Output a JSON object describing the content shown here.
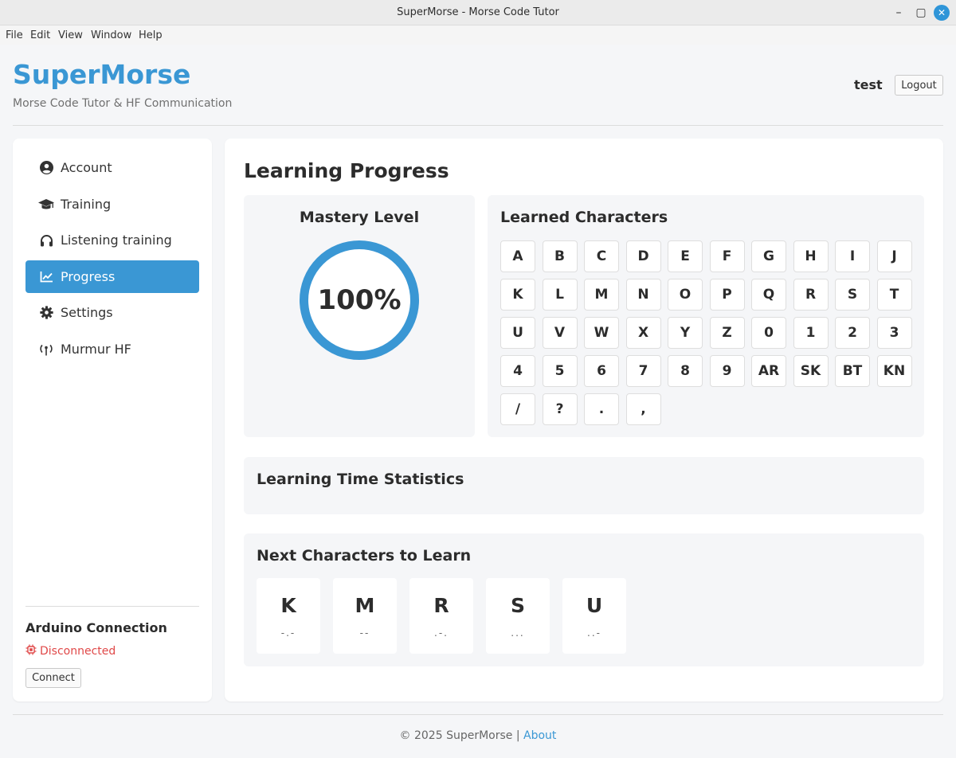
{
  "window": {
    "title": "SuperMorse - Morse Code Tutor",
    "controls": {
      "minimize": "–",
      "maximize": "▢",
      "close": "✕"
    }
  },
  "menubar": [
    "File",
    "Edit",
    "Window",
    "Help",
    "View"
  ],
  "menu": {
    "file": "File",
    "edit": "Edit",
    "view": "View",
    "window": "Window",
    "help": "Help"
  },
  "header": {
    "brand": "SuperMorse",
    "tagline": "Morse Code Tutor & HF Communication",
    "username": "test",
    "logout_label": "Logout"
  },
  "sidebar": {
    "items": [
      {
        "label": "Account",
        "icon": "user-circle-icon"
      },
      {
        "label": "Training",
        "icon": "graduation-cap-icon"
      },
      {
        "label": "Listening training",
        "icon": "headphones-icon"
      },
      {
        "label": "Progress",
        "icon": "chart-line-icon",
        "active": true
      },
      {
        "label": "Settings",
        "icon": "gear-icon"
      },
      {
        "label": "Murmur HF",
        "icon": "antenna-icon"
      }
    ],
    "arduino": {
      "title": "Arduino Connection",
      "status": "Disconnected",
      "connect_label": "Connect"
    }
  },
  "main": {
    "title": "Learning Progress",
    "mastery": {
      "title": "Mastery Level",
      "value": "100%"
    },
    "learned": {
      "title": "Learned Characters",
      "chars": [
        "A",
        "B",
        "C",
        "D",
        "E",
        "F",
        "G",
        "H",
        "I",
        "J",
        "K",
        "L",
        "M",
        "N",
        "O",
        "P",
        "Q",
        "R",
        "S",
        "T",
        "U",
        "V",
        "W",
        "X",
        "Y",
        "Z",
        "0",
        "1",
        "2",
        "3",
        "4",
        "5",
        "6",
        "7",
        "8",
        "9",
        "AR",
        "SK",
        "BT",
        "KN",
        "/",
        "?",
        ".",
        ","
      ]
    },
    "stats": {
      "title": "Learning Time Statistics"
    },
    "next": {
      "title": "Next Characters to Learn",
      "chars": [
        {
          "letter": "K",
          "morse": "-.-"
        },
        {
          "letter": "M",
          "morse": "--"
        },
        {
          "letter": "R",
          "morse": ".-."
        },
        {
          "letter": "S",
          "morse": "..."
        },
        {
          "letter": "U",
          "morse": "..-"
        }
      ]
    }
  },
  "footer": {
    "copyright": "© 2025 SuperMorse |",
    "about": "About"
  },
  "colors": {
    "accent": "#3a97d4",
    "error": "#e04848"
  }
}
